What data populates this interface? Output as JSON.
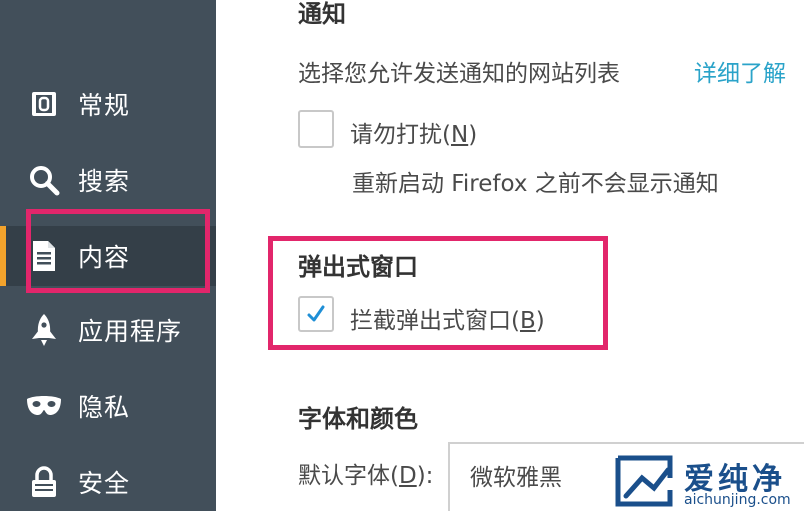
{
  "sidebar": {
    "items": [
      {
        "label": "常规",
        "icon": "general-icon"
      },
      {
        "label": "搜索",
        "icon": "search-icon"
      },
      {
        "label": "内容",
        "icon": "document-icon"
      },
      {
        "label": "应用程序",
        "icon": "rocket-icon"
      },
      {
        "label": "隐私",
        "icon": "mask-icon"
      },
      {
        "label": "安全",
        "icon": "lock-icon"
      }
    ],
    "active_index": 2
  },
  "notifications": {
    "title": "通知",
    "description": "选择您允许发送通知的网站列表",
    "learn_more": "详细了解",
    "dnd_label_prefix": "请勿打扰(",
    "dnd_accesskey": "N",
    "dnd_label_suffix": ")",
    "dnd_checked": false,
    "restart_note": "重新启动 Firefox 之前不会显示通知"
  },
  "popups": {
    "title": "弹出式窗口",
    "block_label_prefix": "拦截弹出式窗口(",
    "block_accesskey": "B",
    "block_label_suffix": ")",
    "block_checked": true
  },
  "fonts": {
    "title": "字体和颜色",
    "default_font_label_prefix": "默认字体(",
    "default_font_accesskey": "D",
    "default_font_label_suffix": "):",
    "default_font_value": "微软雅黑"
  },
  "watermark": {
    "brand": "爱纯净",
    "url": "aichunjing.com"
  },
  "colors": {
    "sidebar_bg": "#424f5a",
    "sidebar_active_bg": "#343f48",
    "active_accent": "#f3a32c",
    "highlight": "#e2266b",
    "link": "#2aa3c9",
    "check": "#1f8fd6"
  }
}
